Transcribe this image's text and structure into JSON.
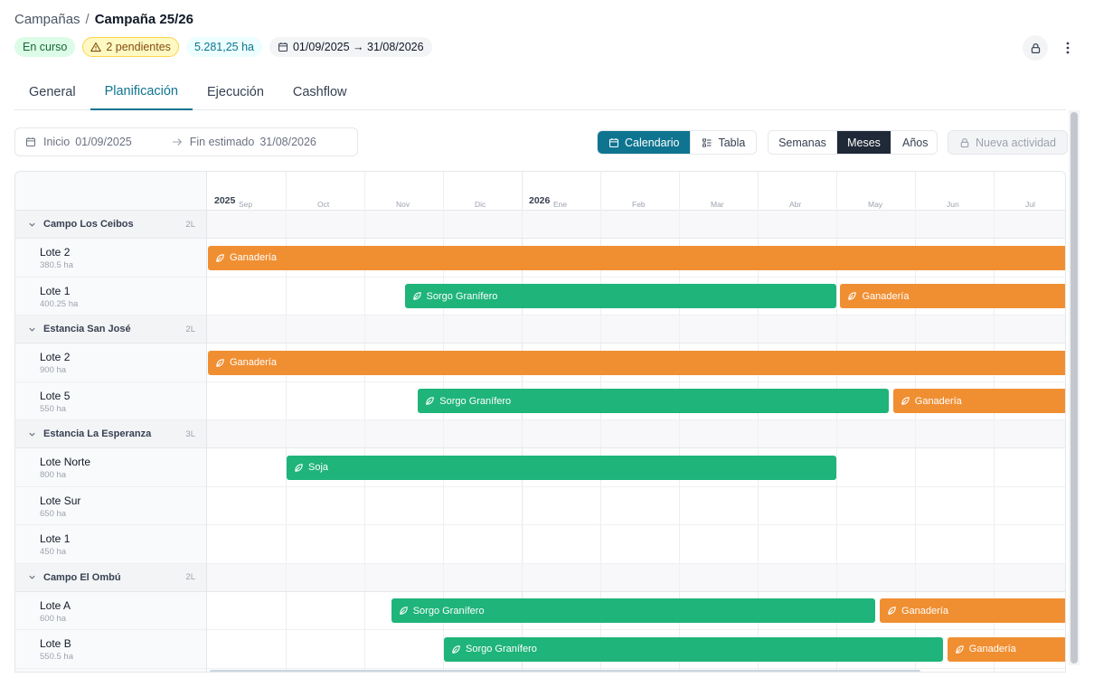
{
  "breadcrumb": {
    "parent": "Campañas",
    "separator": "/",
    "current": "Campaña 25/26"
  },
  "badges": {
    "status": "En curso",
    "pending": "2 pendientes",
    "area": "5.281,25 ha",
    "dates": "01/09/2025 → 31/08/2026"
  },
  "tabs": [
    "General",
    "Planificación",
    "Ejecución",
    "Cashflow"
  ],
  "active_tab": "Planificación",
  "date_range": {
    "start_label": "Inicio",
    "start_value": "01/09/2025",
    "end_label": "Fin estimado",
    "end_value": "31/08/2026"
  },
  "view_toggle": {
    "calendar": "Calendario",
    "table": "Tabla"
  },
  "scale_toggle": {
    "weeks": "Semanas",
    "months": "Meses",
    "years": "Años"
  },
  "new_activity": "Nueva actividad",
  "timeline": {
    "years": [
      "2025",
      "2026"
    ],
    "months": [
      "Sep",
      "Oct",
      "Nov",
      "Dic",
      "Ene",
      "Feb",
      "Mar",
      "Abr",
      "May",
      "Jun",
      "Jul"
    ]
  },
  "groups": [
    {
      "name": "Campo Los Ceibos",
      "count": "2L",
      "lotes": [
        {
          "name": "Lote 2",
          "ha": "380.5 ha",
          "bars": [
            {
              "label": "Ganadería",
              "color": "#f08f32",
              "start": 0,
              "end": 11.2
            }
          ]
        },
        {
          "name": "Lote 1",
          "ha": "400.25 ha",
          "bars": [
            {
              "label": "Sorgo Granífero",
              "color": "#1fb47a",
              "start": 2.5,
              "end": 8.0
            },
            {
              "label": "Ganadería",
              "color": "#f08f32",
              "start": 8.04,
              "end": 11.2
            }
          ]
        }
      ]
    },
    {
      "name": "Estancia San José",
      "count": "2L",
      "lotes": [
        {
          "name": "Lote 2",
          "ha": "900 ha",
          "bars": [
            {
              "label": "Ganadería",
              "color": "#f08f32",
              "start": 0,
              "end": 11.2
            }
          ]
        },
        {
          "name": "Lote 5",
          "ha": "550 ha",
          "bars": [
            {
              "label": "Sorgo Granífero",
              "color": "#1fb47a",
              "start": 2.67,
              "end": 8.67
            },
            {
              "label": "Ganadería",
              "color": "#f08f32",
              "start": 8.71,
              "end": 11.2
            }
          ]
        }
      ]
    },
    {
      "name": "Estancia La Esperanza",
      "count": "3L",
      "lotes": [
        {
          "name": "Lote Norte",
          "ha": "800 ha",
          "bars": [
            {
              "label": "Soja",
              "color": "#1fb47a",
              "start": 1.0,
              "end": 8.0
            }
          ]
        },
        {
          "name": "Lote Sur",
          "ha": "650 ha",
          "bars": []
        },
        {
          "name": "Lote 1",
          "ha": "450 ha",
          "bars": []
        }
      ]
    },
    {
      "name": "Campo El Ombú",
      "count": "2L",
      "lotes": [
        {
          "name": "Lote A",
          "ha": "600 ha",
          "bars": [
            {
              "label": "Sorgo Granífero",
              "color": "#1fb47a",
              "start": 2.33,
              "end": 8.5
            },
            {
              "label": "Ganadería",
              "color": "#f08f32",
              "start": 8.54,
              "end": 11.2
            }
          ]
        },
        {
          "name": "Lote B",
          "ha": "550.5 ha",
          "bars": [
            {
              "label": "Sorgo Granífero",
              "color": "#1fb47a",
              "start": 3.0,
              "end": 9.36
            },
            {
              "label": "Ganadería",
              "color": "#f08f32",
              "start": 9.4,
              "end": 11.2
            }
          ]
        }
      ]
    }
  ]
}
